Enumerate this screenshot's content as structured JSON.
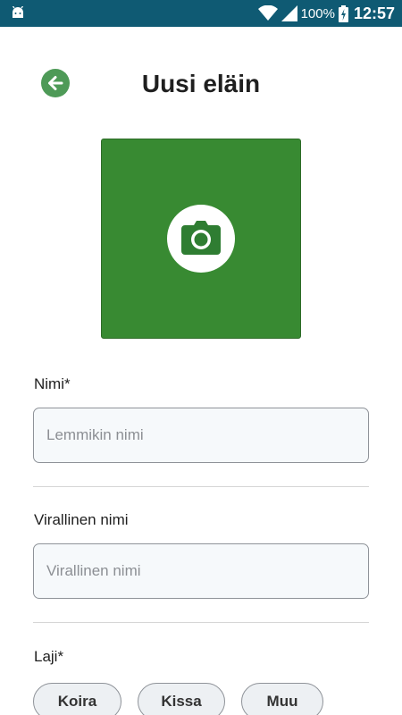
{
  "statusbar": {
    "battery": "100%",
    "time": "12:57",
    "icons": [
      "android-icon",
      "wifi-icon",
      "signal-icon",
      "battery-charging-icon"
    ]
  },
  "header": {
    "title": "Uusi eläin",
    "back_icon": "arrow-left-icon"
  },
  "photo": {
    "icon": "camera-icon",
    "background": "#388a32"
  },
  "form": {
    "name_label": "Nimi*",
    "name_placeholder": "Lemmikin nimi",
    "name_value": "",
    "official_label": "Virallinen nimi",
    "official_placeholder": "Virallinen nimi",
    "official_value": "",
    "species_label": "Laji*",
    "species_options": [
      "Koira",
      "Kissa",
      "Muu"
    ]
  },
  "colors": {
    "statusbar": "#0f5a73",
    "accent": "#4e9a57"
  }
}
